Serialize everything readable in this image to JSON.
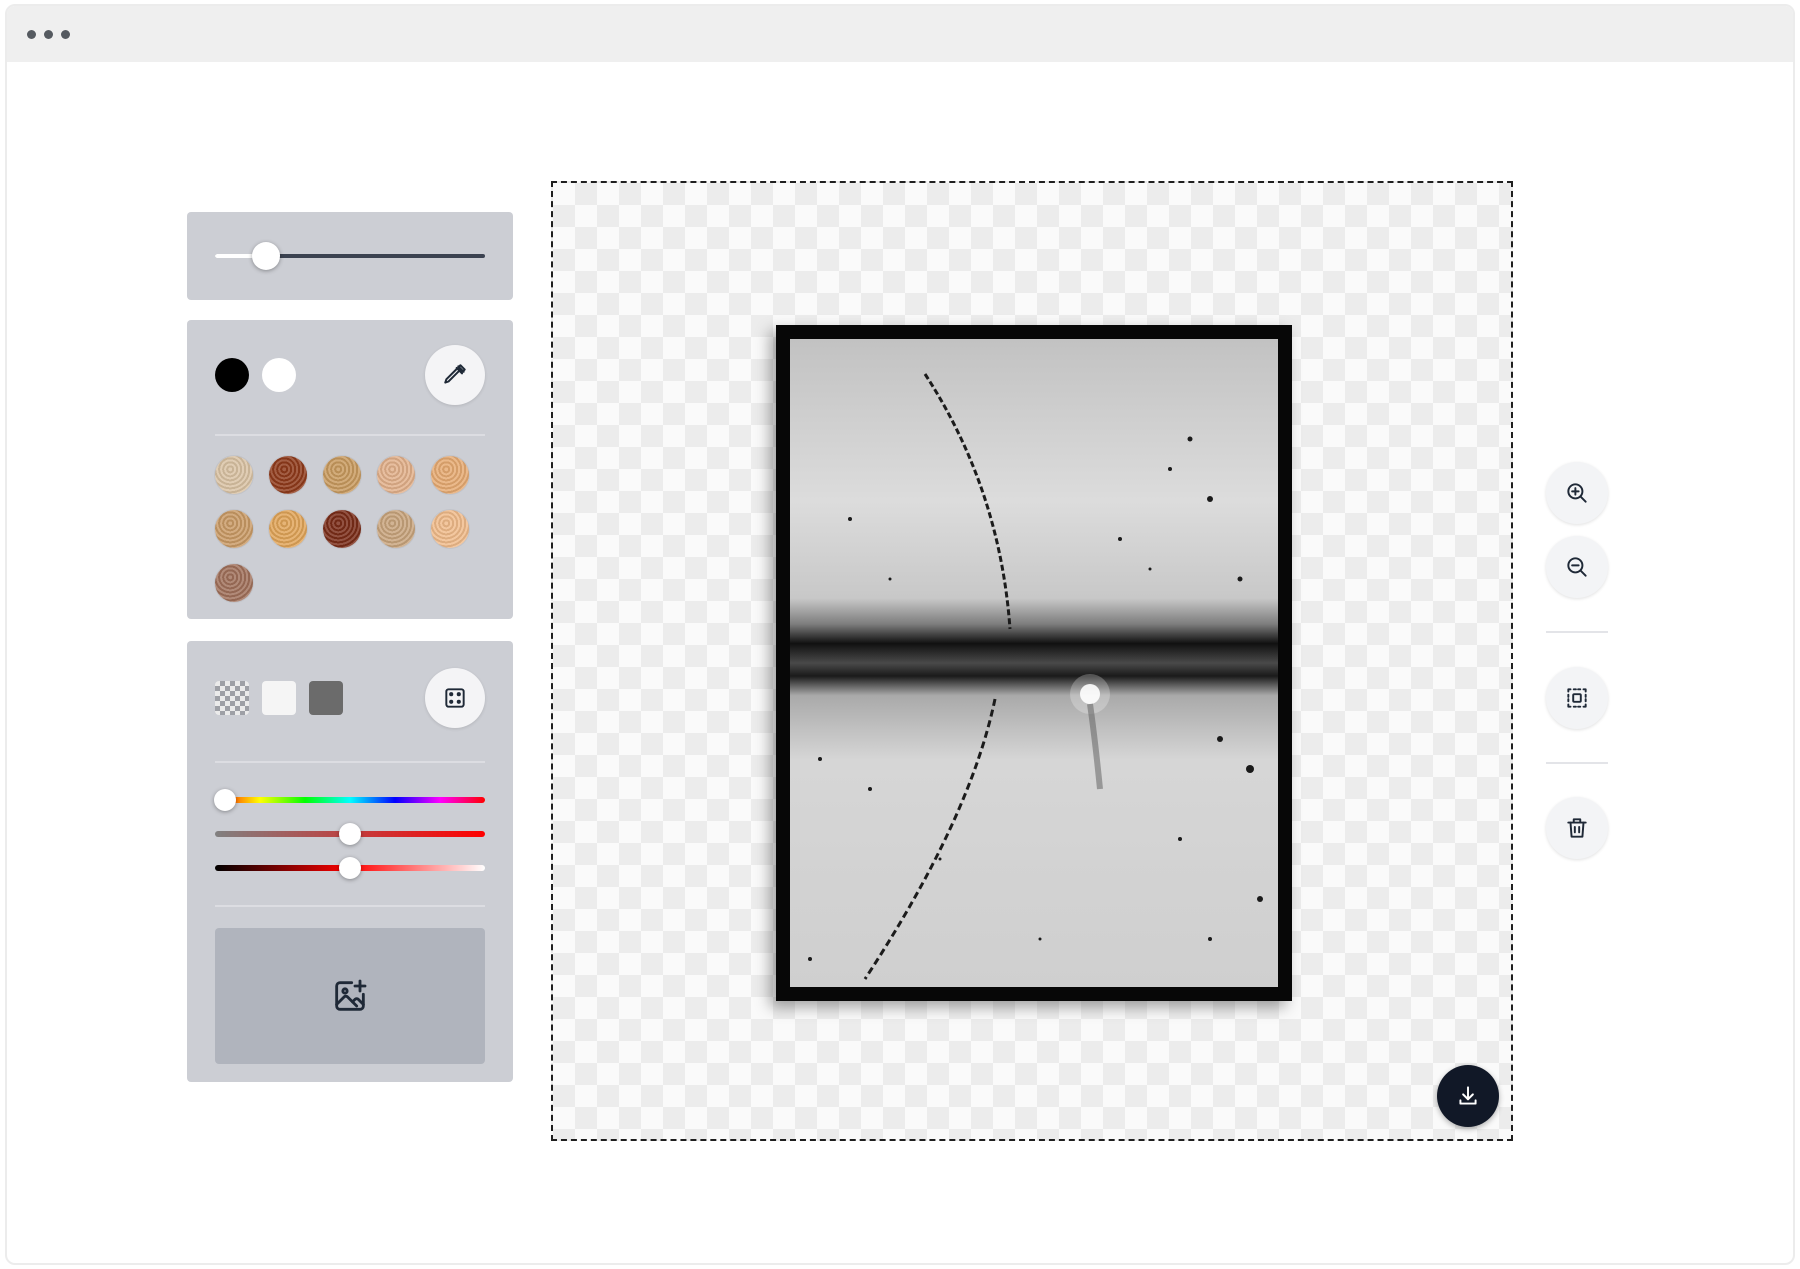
{
  "window": {
    "controls": [
      "dot",
      "dot",
      "dot"
    ]
  },
  "brush": {
    "size_fraction": 0.19
  },
  "colors": {
    "basic": [
      {
        "name": "black",
        "color": "#000000"
      },
      {
        "name": "white",
        "color": "#ffffff"
      }
    ],
    "picker_icon": "eyedropper-icon",
    "wood_textures": [
      {
        "name": "wood-1",
        "color": "#d9c2a3"
      },
      {
        "name": "wood-2",
        "color": "#8f3b1b"
      },
      {
        "name": "wood-3",
        "color": "#c89a5e"
      },
      {
        "name": "wood-4",
        "color": "#e2b08a"
      },
      {
        "name": "wood-5",
        "color": "#e6aa72"
      },
      {
        "name": "wood-6",
        "color": "#c99a65"
      },
      {
        "name": "wood-7",
        "color": "#e0a458"
      },
      {
        "name": "wood-8",
        "color": "#7a2c18"
      },
      {
        "name": "wood-9",
        "color": "#c8a47c"
      },
      {
        "name": "wood-10",
        "color": "#f0bb8a"
      },
      {
        "name": "wood-11",
        "color": "#a0705a"
      }
    ]
  },
  "background": {
    "options": [
      {
        "name": "transparent"
      },
      {
        "name": "light",
        "color": "#f5f5f5"
      },
      {
        "name": "dark",
        "color": "#6b6b6b"
      }
    ],
    "random_icon": "dice-icon",
    "hue": 0.0,
    "saturation": 0.5,
    "lightness": 0.5,
    "upload_icon": "image-add-icon"
  },
  "canvas": {
    "image_icon": "photo",
    "download_icon": "download-icon"
  },
  "tools": {
    "zoom_in": "zoom-in-icon",
    "zoom_out": "zoom-out-icon",
    "fit": "fit-to-screen-icon",
    "delete": "trash-icon"
  },
  "accent": "#111827"
}
